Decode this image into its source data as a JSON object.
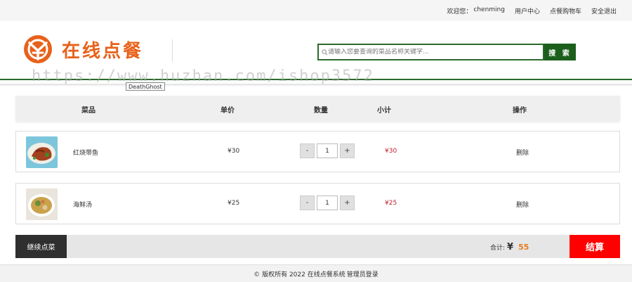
{
  "topbar": {
    "welcome_label": "欢迎您：",
    "username": "chenming",
    "user_center": "用户中心",
    "cart": "点餐购物车",
    "logout": "安全退出"
  },
  "header": {
    "logo_text": "在线点餐",
    "search_placeholder": "请输入您要查询的菜品名称关键字...",
    "search_button": "搜 索"
  },
  "overlay": {
    "watermark": "https://www.huzhan.com/ishop3572",
    "tooltip": "DeathGhost"
  },
  "cart": {
    "columns": {
      "dish": "菜品",
      "price": "单价",
      "quantity": "数量",
      "subtotal": "小计",
      "actions": "操作"
    },
    "items": [
      {
        "name": "红烧带鱼",
        "price": "¥30",
        "minus": "-",
        "quantity": "1",
        "plus": "+",
        "subtotal": "¥30",
        "delete": "删除",
        "image_icon": "braised-fish-photo"
      },
      {
        "name": "海鲜汤",
        "price": "¥25",
        "minus": "-",
        "quantity": "1",
        "plus": "+",
        "subtotal": "¥25",
        "delete": "删除",
        "image_icon": "seafood-soup-photo"
      }
    ],
    "continue_button": "继续点菜",
    "total_label": "合计:",
    "currency_symbol": "¥",
    "total_amount": "55",
    "checkout_button": "结算"
  },
  "footer": {
    "copyright": "© 版权所有 2022 在线点餐系统",
    "admin_login": "管理员登录"
  },
  "colors": {
    "brand_orange": "#e8611a",
    "search_green": "#1c5e1c",
    "price_red": "#c0202e",
    "checkout_red": "#ff0000",
    "total_orange": "#e87a1c"
  }
}
